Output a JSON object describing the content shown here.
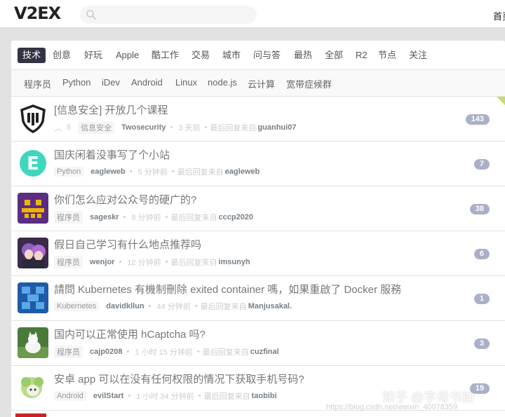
{
  "header": {
    "logo": "V2EX",
    "search_placeholder": "",
    "home": "首页"
  },
  "tabs": [
    "技术",
    "创意",
    "好玩",
    "Apple",
    "酷工作",
    "交易",
    "城市",
    "问与答",
    "最热",
    "全部",
    "R2",
    "节点",
    "关注"
  ],
  "subtabs": [
    "程序员",
    "Python",
    "iDev",
    "Android",
    "Linux",
    "node.js",
    "云计算",
    "宽带症候群"
  ],
  "topics": [
    {
      "title": "[信息安全] 开放几个课程",
      "upvotes": "8",
      "node": "信息安全",
      "author": "Twosecurity",
      "time": "3 天前",
      "reply_label": "最后回复来自",
      "last_reply": "guanhui07",
      "replies": "143",
      "avatar_icon": "shield-logo-icon"
    },
    {
      "title": "国庆闲着没事写了个小站",
      "node": "Python",
      "author": "eagleweb",
      "time": "5 分钟前",
      "reply_label": "最后回复来自",
      "last_reply": "eagleweb",
      "replies": "7",
      "avatar_icon": "letter-e-logo-icon"
    },
    {
      "title": "你们怎么应对公众号的硬广的?",
      "node": "程序员",
      "author": "sageskr",
      "time": "8 分钟前",
      "reply_label": "最后回复来自",
      "last_reply": "cccp2020",
      "replies": "38",
      "avatar_icon": "pixel-avatar-icon"
    },
    {
      "title": "假日自己学习有什么地点推荐吗",
      "node": "程序员",
      "author": "wenjor",
      "time": "12 分钟前",
      "reply_label": "最后回复来自",
      "last_reply": "imsunyh",
      "replies": "6",
      "avatar_icon": "anime-avatar-icon"
    },
    {
      "title": "請問 Kubernetes 有機制刪除 exited container 嗎，如果重啟了 Docker 服務",
      "node": "Kubernetes",
      "author": "davidkllun",
      "time": "44 分钟前",
      "reply_label": "最后回复来自",
      "last_reply": "Manjusakal.",
      "replies": "1",
      "avatar_icon": "blue-block-avatar-icon"
    },
    {
      "title": "国内可以正常使用 hCaptcha 吗?",
      "node": "程序员",
      "author": "cajp0208",
      "time": "1 小时 15 分钟前",
      "reply_label": "最后回复来自",
      "last_reply": "cuzfinal",
      "replies": "3",
      "avatar_icon": "cat-photo-avatar-icon"
    },
    {
      "title": "安卓 app 可以在没有任何权限的情况下获取手机号码?",
      "node": "Android",
      "author": "evilStart",
      "time": "1 小时 34 分钟前",
      "reply_label": "最后回复来自",
      "last_reply": "taobibi",
      "replies": "19",
      "avatar_icon": "green-creature-avatar-icon"
    }
  ],
  "watermark": {
    "zhihu": "知乎 @字母书拍",
    "csdn": "https://blog.csdn.net/weixin_40078359"
  },
  "colors": {
    "active_tab_bg": "#334",
    "reply_count_bg": "#aab0c6",
    "page_bg": "#e2e2e2"
  }
}
